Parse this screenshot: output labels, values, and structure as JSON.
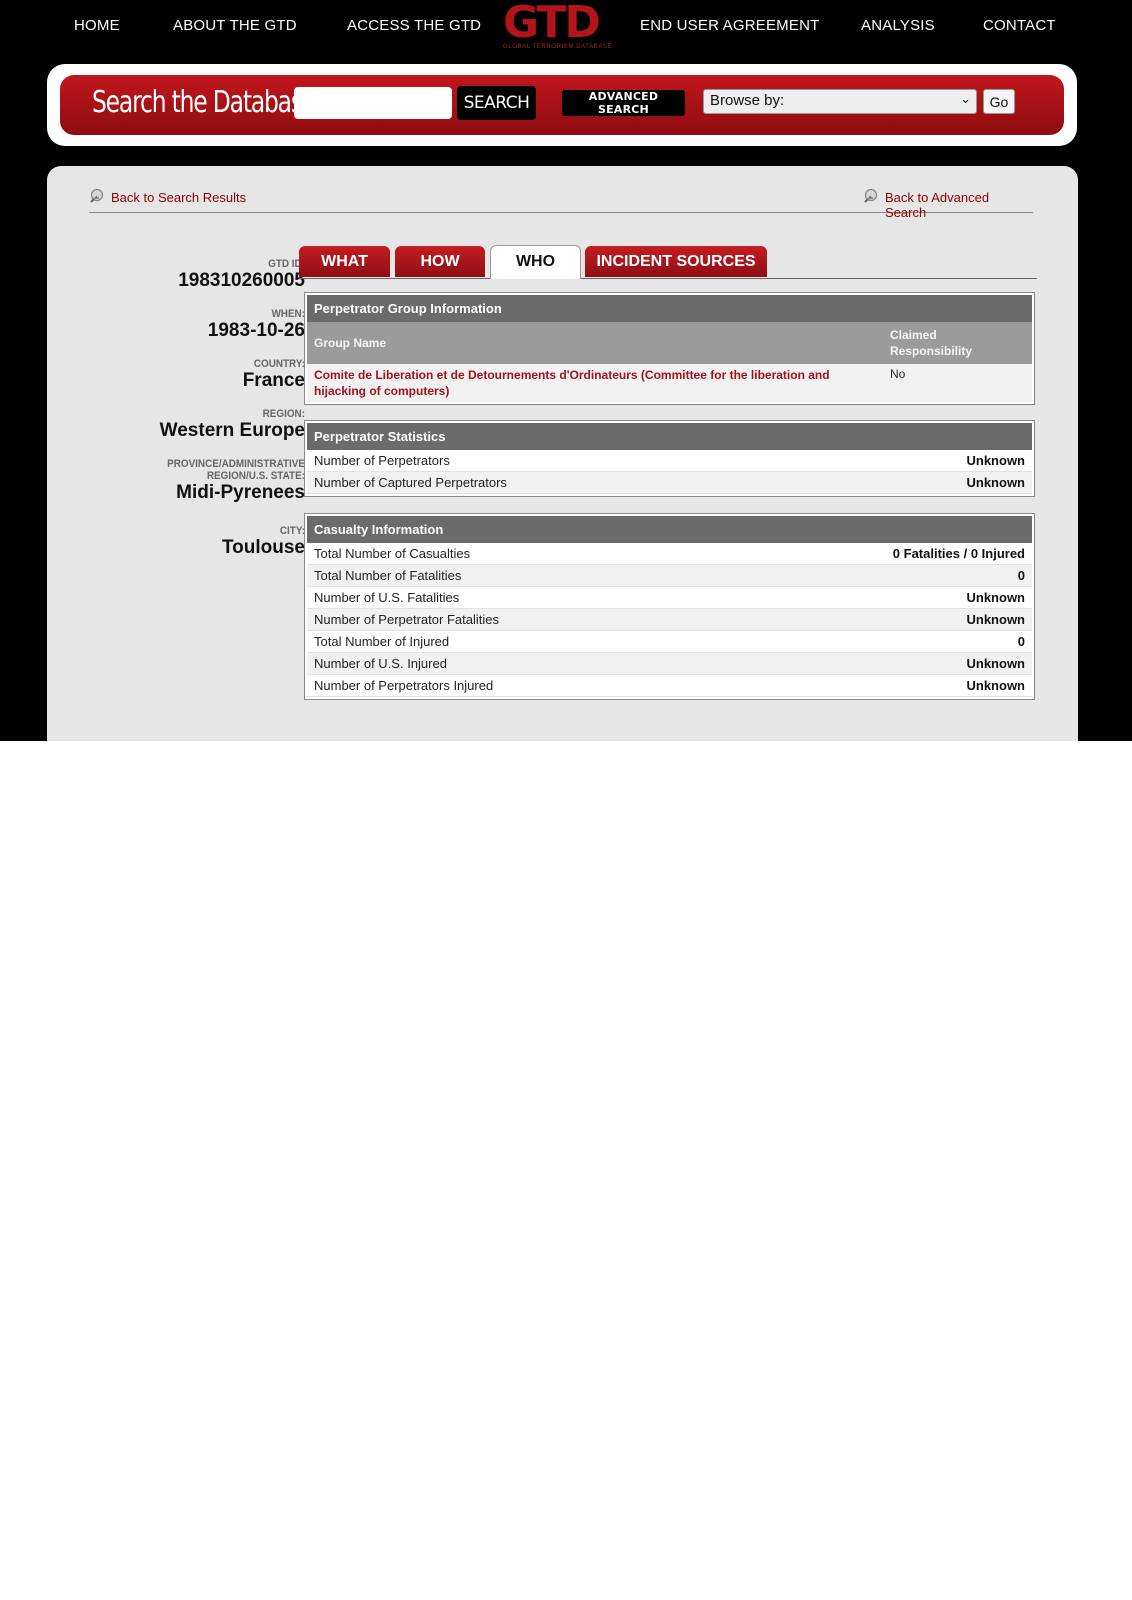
{
  "nav": {
    "items": [
      "HOME",
      "ABOUT THE GTD",
      "ACCESS THE GTD",
      "END USER AGREEMENT",
      "ANALYSIS",
      "CONTACT"
    ],
    "logo_text": "GTD",
    "logo_subtitle": "GLOBAL TERRORISM DATABASE"
  },
  "search": {
    "title": "Search the Database",
    "input_value": "",
    "search_label": "SEARCH",
    "advanced_label": "ADVANCED SEARCH",
    "browse_label": "Browse by:",
    "go_label": "Go"
  },
  "links": {
    "back_results": "Back to Search Results",
    "back_advanced": "Back to Advanced Search"
  },
  "meta": {
    "gtd_id_label": "GTD ID:",
    "gtd_id": "198310260005",
    "when_label": "WHEN:",
    "when": "1983-10-26",
    "country_label": "COUNTRY:",
    "country": "France",
    "region_label": "REGION:",
    "region": "Western Europe",
    "province_label_1": "PROVINCE/ADMINISTRATIVE",
    "province_label_2": "REGION/U.S. STATE:",
    "province": "Midi-Pyrenees",
    "city_label": "CITY:",
    "city": "Toulouse"
  },
  "tabs": [
    "WHAT",
    "HOW",
    "WHO",
    "INCIDENT SOURCES"
  ],
  "perpetrator_group": {
    "header": "Perpetrator Group Information",
    "col_group": "Group Name",
    "col_claim_1": "Claimed",
    "col_claim_2": "Responsibility",
    "group_line_1": "Comite de Liberation et de Detournements d'Ordinateurs (Committee for the liberation and",
    "group_line_2": "hijacking of computers)",
    "claimed": "No"
  },
  "perpetrator_stats": {
    "header": "Perpetrator Statistics",
    "rows": [
      {
        "label": "Number of Perpetrators",
        "value": "Unknown"
      },
      {
        "label": "Number of Captured Perpetrators",
        "value": "Unknown"
      }
    ]
  },
  "casualty": {
    "header": "Casualty Information",
    "rows": [
      {
        "label": "Total Number of Casualties",
        "value": "0 Fatalities / 0 Injured"
      },
      {
        "label": "Total Number of Fatalities",
        "value": "0"
      },
      {
        "label": "Number of U.S. Fatalities",
        "value": "Unknown"
      },
      {
        "label": "Number of Perpetrator Fatalities",
        "value": "Unknown"
      },
      {
        "label": "Total Number of Injured",
        "value": "0"
      },
      {
        "label": "Number of U.S. Injured",
        "value": "Unknown"
      },
      {
        "label": "Number of Perpetrators Injured",
        "value": "Unknown"
      }
    ]
  },
  "colors": {
    "brand_red": "#b3141a",
    "link_red": "#8b0000",
    "header_gray": "#6b6b6b"
  }
}
